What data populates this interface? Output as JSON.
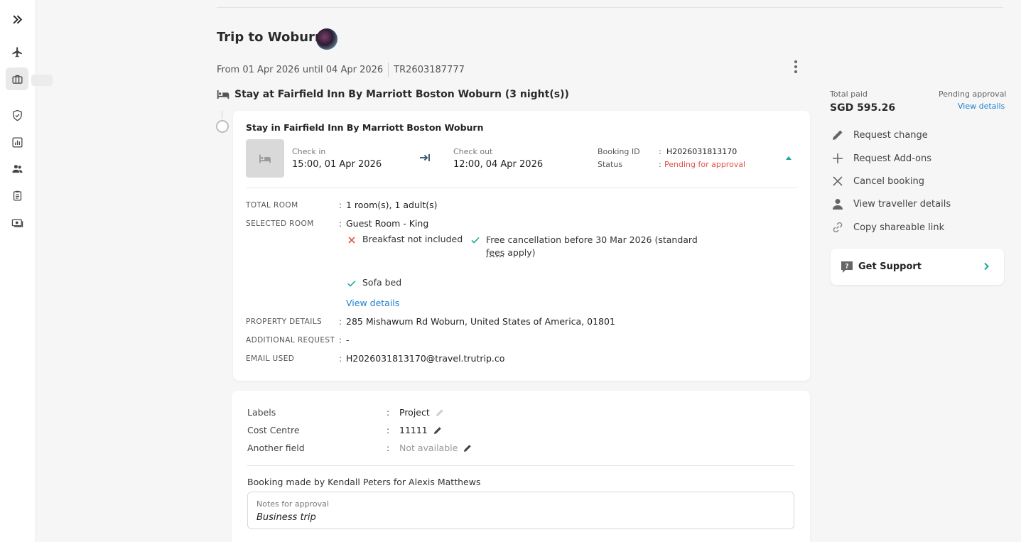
{
  "trip": {
    "title": "Trip to Woburn",
    "dates": "From 01 Apr 2026 until 04 Apr 2026",
    "reference": "TR2603187777"
  },
  "stay": {
    "heading": "Stay at Fairfield Inn By Marriott Boston Woburn (3 night(s))",
    "card_title": "Stay in Fairfield Inn By Marriott Boston Woburn",
    "check_in_label": "Check in",
    "check_in_value": "15:00, 01 Apr 2026",
    "check_out_label": "Check out",
    "check_out_value": "12:00, 04 Apr 2026",
    "booking_id_label": "Booking ID",
    "booking_id_value": "H2026031813170",
    "status_label": "Status",
    "status_value": "Pending for approval",
    "details": {
      "total_room_label": "TOTAL ROOM",
      "total_room_value": "1 room(s), 1 adult(s)",
      "selected_room_label": "SELECTED ROOM",
      "selected_room_value": "Guest Room - King",
      "breakfast": "Breakfast not included",
      "cancellation_1": "Free cancellation before 30 Mar 2026 (standard",
      "cancellation_fees": "fees",
      "cancellation_2": " apply)",
      "sofa": "Sofa bed",
      "view_details": "View details",
      "property_label": "PROPERTY DETAILS",
      "property_value": "285 Mishawum Rd Woburn, United States of America, 01801",
      "additional_label": "ADDITIONAL REQUEST",
      "additional_value": "-",
      "email_label": "EMAIL USED",
      "email_value": "H2026031813170@travel.trutrip.co"
    }
  },
  "fields": {
    "labels_label": "Labels",
    "labels_value": "Project",
    "cost_centre_label": "Cost Centre",
    "cost_centre_value": "11111",
    "another_label": "Another field",
    "another_value": "Not available",
    "colon": ":",
    "made_by": "Booking made by Kendall Peters for Alexis Matthews",
    "notes_label": "Notes for approval",
    "notes_value": "Business trip"
  },
  "summary": {
    "total_paid_label": "Total paid",
    "total_paid_value": "SGD 595.26",
    "pending_label": "Pending approval",
    "view_details": "View details"
  },
  "actions": [
    {
      "label": "Request change",
      "icon": "pencil-icon"
    },
    {
      "label": "Request Add-ons",
      "icon": "plus-icon"
    },
    {
      "label": "Cancel booking",
      "icon": "close-icon"
    },
    {
      "label": "View traveller details",
      "icon": "person-icon"
    },
    {
      "label": "Copy shareable link",
      "icon": "link-icon"
    }
  ],
  "support": {
    "label": "Get Support"
  },
  "colors": {
    "accent": "#1a7fd1",
    "status_pending": "#e5534b",
    "check_green": "#1aa79b",
    "cross_red": "#e5534b"
  }
}
